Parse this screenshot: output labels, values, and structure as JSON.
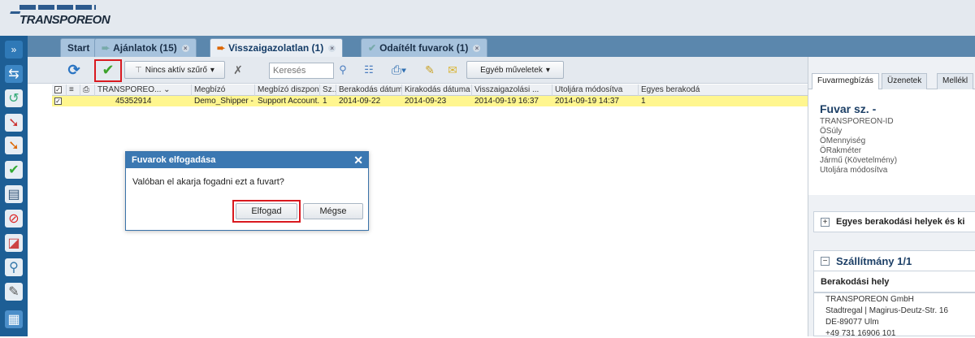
{
  "app": {
    "logo_text": "TRANSPOREON"
  },
  "tabs": [
    {
      "label": "Start"
    },
    {
      "label": "Ajánlatok (15)"
    },
    {
      "label": "Visszaigazolatlan (1)"
    },
    {
      "label": "Odaítélt fuvarok (1)"
    }
  ],
  "toolbar": {
    "filter_label": "Nincs aktív szűrő",
    "search_placeholder": "Keresés",
    "more_actions_label": "Egyéb műveletek"
  },
  "grid": {
    "columns": [
      "TRANSPOREO...",
      "Megbízó",
      "Megbízó diszpon...",
      "Sz...",
      "Berakodás dátuma",
      "Kirakodás dátuma",
      "Visszaigazolási ...",
      "Utoljára módosítva",
      "Egyes berakodá"
    ],
    "rows": [
      {
        "id": "45352914",
        "shipper": "Demo_Shipper - ...",
        "dispatcher": "Support Account...",
        "sz": "1",
        "loading_date": "2014-09-22",
        "unloading_date": "2014-09-23",
        "confirm": "2014-09-19 16:37",
        "modified": "2014-09-19 14:37",
        "loads": "1"
      }
    ]
  },
  "dialog": {
    "title": "Fuvarok elfogadása",
    "message": "Valóban el akarja fogadni ezt a fuvart?",
    "accept_label": "Elfogad",
    "cancel_label": "Mégse"
  },
  "panel": {
    "tabs": [
      "Fuvarmegbízás",
      "Üzenetek",
      "Mellékl"
    ],
    "title": "Fuvar sz. -",
    "fields": [
      "TRANSPOREON-ID",
      "ÖSúly",
      "ÖMennyiség",
      "ÖRakméter",
      "Jármű (Követelmény)",
      "Utoljára módosítva"
    ],
    "section_loading": "Egyes berakodási helyek és ki",
    "section_shipment": "Szállítmány 1/1",
    "loading_place_label": "Berakodási hely",
    "address": [
      "TRANSPOREON GmbH",
      "Stadtregal | Magirus-Deutz-Str. 16",
      "DE-89077 Ulm",
      "+49 731 16906 101"
    ]
  },
  "colors": {
    "accent": "#1d5e95",
    "highlight_row": "#fff68f",
    "dialog_header": "#3b78b2",
    "annotation_red": "#d9191f"
  }
}
